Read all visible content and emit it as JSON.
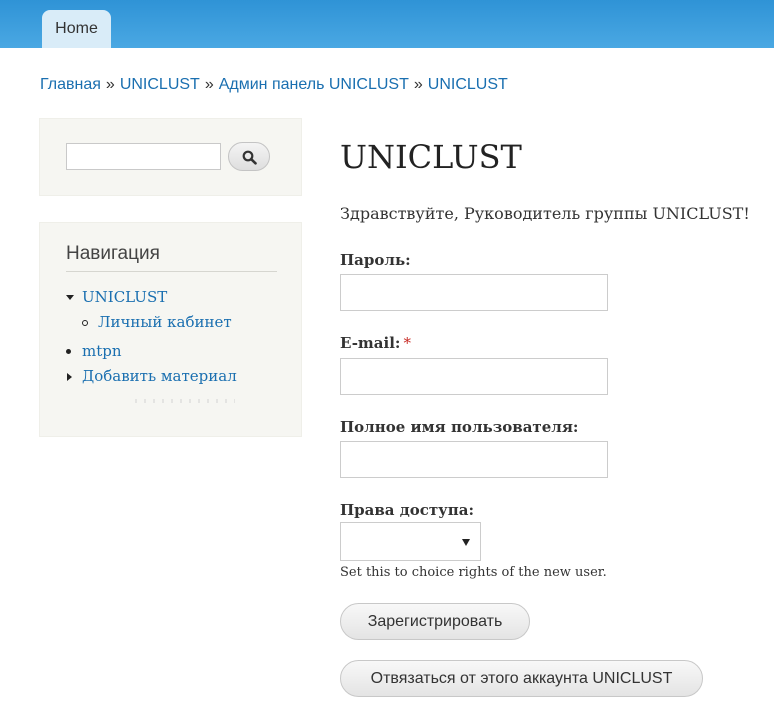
{
  "header": {
    "tabs": [
      {
        "label": "Home"
      }
    ]
  },
  "breadcrumb": {
    "items": [
      "Главная",
      "UNICLUST",
      "Админ панель UNICLUST",
      "UNICLUST"
    ],
    "separator": "»"
  },
  "sidebar": {
    "search": {
      "value": "",
      "button_icon": "search-icon"
    },
    "navigation": {
      "title": "Навигация",
      "items": [
        {
          "label": "UNICLUST",
          "state": "expanded"
        },
        {
          "label": "Личный кабинет",
          "level": 2
        },
        {
          "label": "mtpn"
        },
        {
          "label": "Добавить материал",
          "state": "collapsed"
        }
      ]
    }
  },
  "main": {
    "title": "UNICLUST",
    "greeting": "Здравствуйте, Руководитель группы UNICLUST!",
    "fields": {
      "password_label": "Пароль:",
      "email_label": "E-mail:",
      "required_mark": "*",
      "fullname_label": "Полное имя пользователя:",
      "access_label": "Права доступа:"
    },
    "access_select": {
      "selected": ""
    },
    "hint": "Set this to choice rights of the new user.",
    "register_button": "Зарегистрировать",
    "unlink_button": "Отвязаться от этого аккаунта UNICLUST"
  },
  "colors": {
    "topbar": "#2f93d6",
    "link": "#1a6fb0",
    "required": "#c72a24",
    "sidebar_bg": "#f6f6f2"
  }
}
